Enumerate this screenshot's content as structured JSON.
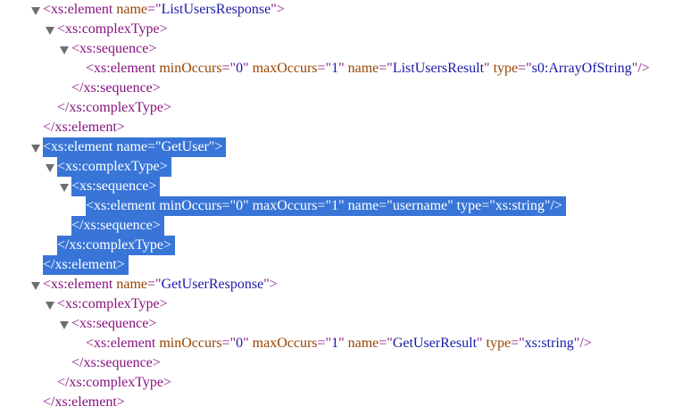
{
  "lines": [
    {
      "indent": 0,
      "toggle": true,
      "selected": false,
      "kind": "open",
      "tag": "xs:element",
      "attrs": [
        {
          "name": "name",
          "value": "ListUsersResponse"
        }
      ]
    },
    {
      "indent": 1,
      "toggle": true,
      "selected": false,
      "kind": "open",
      "tag": "xs:complexType",
      "attrs": []
    },
    {
      "indent": 2,
      "toggle": true,
      "selected": false,
      "kind": "open",
      "tag": "xs:sequence",
      "attrs": []
    },
    {
      "indent": 3,
      "toggle": false,
      "selected": false,
      "kind": "self",
      "tag": "xs:element",
      "attrs": [
        {
          "name": "minOccurs",
          "value": "0"
        },
        {
          "name": "maxOccurs",
          "value": "1"
        },
        {
          "name": "name",
          "value": "ListUsersResult"
        },
        {
          "name": "type",
          "value": "s0:ArrayOfString"
        }
      ]
    },
    {
      "indent": 2,
      "toggle": false,
      "selected": false,
      "kind": "close",
      "tag": "xs:sequence",
      "attrs": []
    },
    {
      "indent": 1,
      "toggle": false,
      "selected": false,
      "kind": "close",
      "tag": "xs:complexType",
      "attrs": []
    },
    {
      "indent": 0,
      "toggle": false,
      "selected": false,
      "kind": "close",
      "tag": "xs:element",
      "attrs": []
    },
    {
      "indent": 0,
      "toggle": true,
      "selected": true,
      "kind": "open",
      "tag": "xs:element",
      "attrs": [
        {
          "name": "name",
          "value": "GetUser"
        }
      ]
    },
    {
      "indent": 1,
      "toggle": true,
      "selected": true,
      "kind": "open",
      "tag": "xs:complexType",
      "attrs": []
    },
    {
      "indent": 2,
      "toggle": true,
      "selected": true,
      "kind": "open",
      "tag": "xs:sequence",
      "attrs": []
    },
    {
      "indent": 3,
      "toggle": false,
      "selected": true,
      "kind": "self",
      "tag": "xs:element",
      "attrs": [
        {
          "name": "minOccurs",
          "value": "0"
        },
        {
          "name": "maxOccurs",
          "value": "1"
        },
        {
          "name": "name",
          "value": "username"
        },
        {
          "name": "type",
          "value": "xs:string"
        }
      ]
    },
    {
      "indent": 2,
      "toggle": false,
      "selected": true,
      "kind": "close",
      "tag": "xs:sequence",
      "attrs": []
    },
    {
      "indent": 1,
      "toggle": false,
      "selected": true,
      "kind": "close",
      "tag": "xs:complexType",
      "attrs": []
    },
    {
      "indent": 0,
      "toggle": false,
      "selected": true,
      "kind": "close",
      "tag": "xs:element",
      "attrs": []
    },
    {
      "indent": 0,
      "toggle": true,
      "selected": false,
      "kind": "open",
      "tag": "xs:element",
      "attrs": [
        {
          "name": "name",
          "value": "GetUserResponse"
        }
      ]
    },
    {
      "indent": 1,
      "toggle": true,
      "selected": false,
      "kind": "open",
      "tag": "xs:complexType",
      "attrs": []
    },
    {
      "indent": 2,
      "toggle": true,
      "selected": false,
      "kind": "open",
      "tag": "xs:sequence",
      "attrs": []
    },
    {
      "indent": 3,
      "toggle": false,
      "selected": false,
      "kind": "self",
      "tag": "xs:element",
      "attrs": [
        {
          "name": "minOccurs",
          "value": "0"
        },
        {
          "name": "maxOccurs",
          "value": "1"
        },
        {
          "name": "name",
          "value": "GetUserResult"
        },
        {
          "name": "type",
          "value": "xs:string"
        }
      ]
    },
    {
      "indent": 2,
      "toggle": false,
      "selected": false,
      "kind": "close",
      "tag": "xs:sequence",
      "attrs": []
    },
    {
      "indent": 1,
      "toggle": false,
      "selected": false,
      "kind": "close",
      "tag": "xs:complexType",
      "attrs": []
    },
    {
      "indent": 0,
      "toggle": false,
      "selected": false,
      "kind": "close",
      "tag": "xs:element",
      "attrs": []
    }
  ],
  "colors": {
    "tag": "#881280",
    "attr_name": "#994500",
    "attr_value": "#1a1aa6",
    "selection": "#3875d7",
    "toggle": "#6e6e6e"
  },
  "icons": {
    "expand_toggle": "triangle-down-icon"
  }
}
